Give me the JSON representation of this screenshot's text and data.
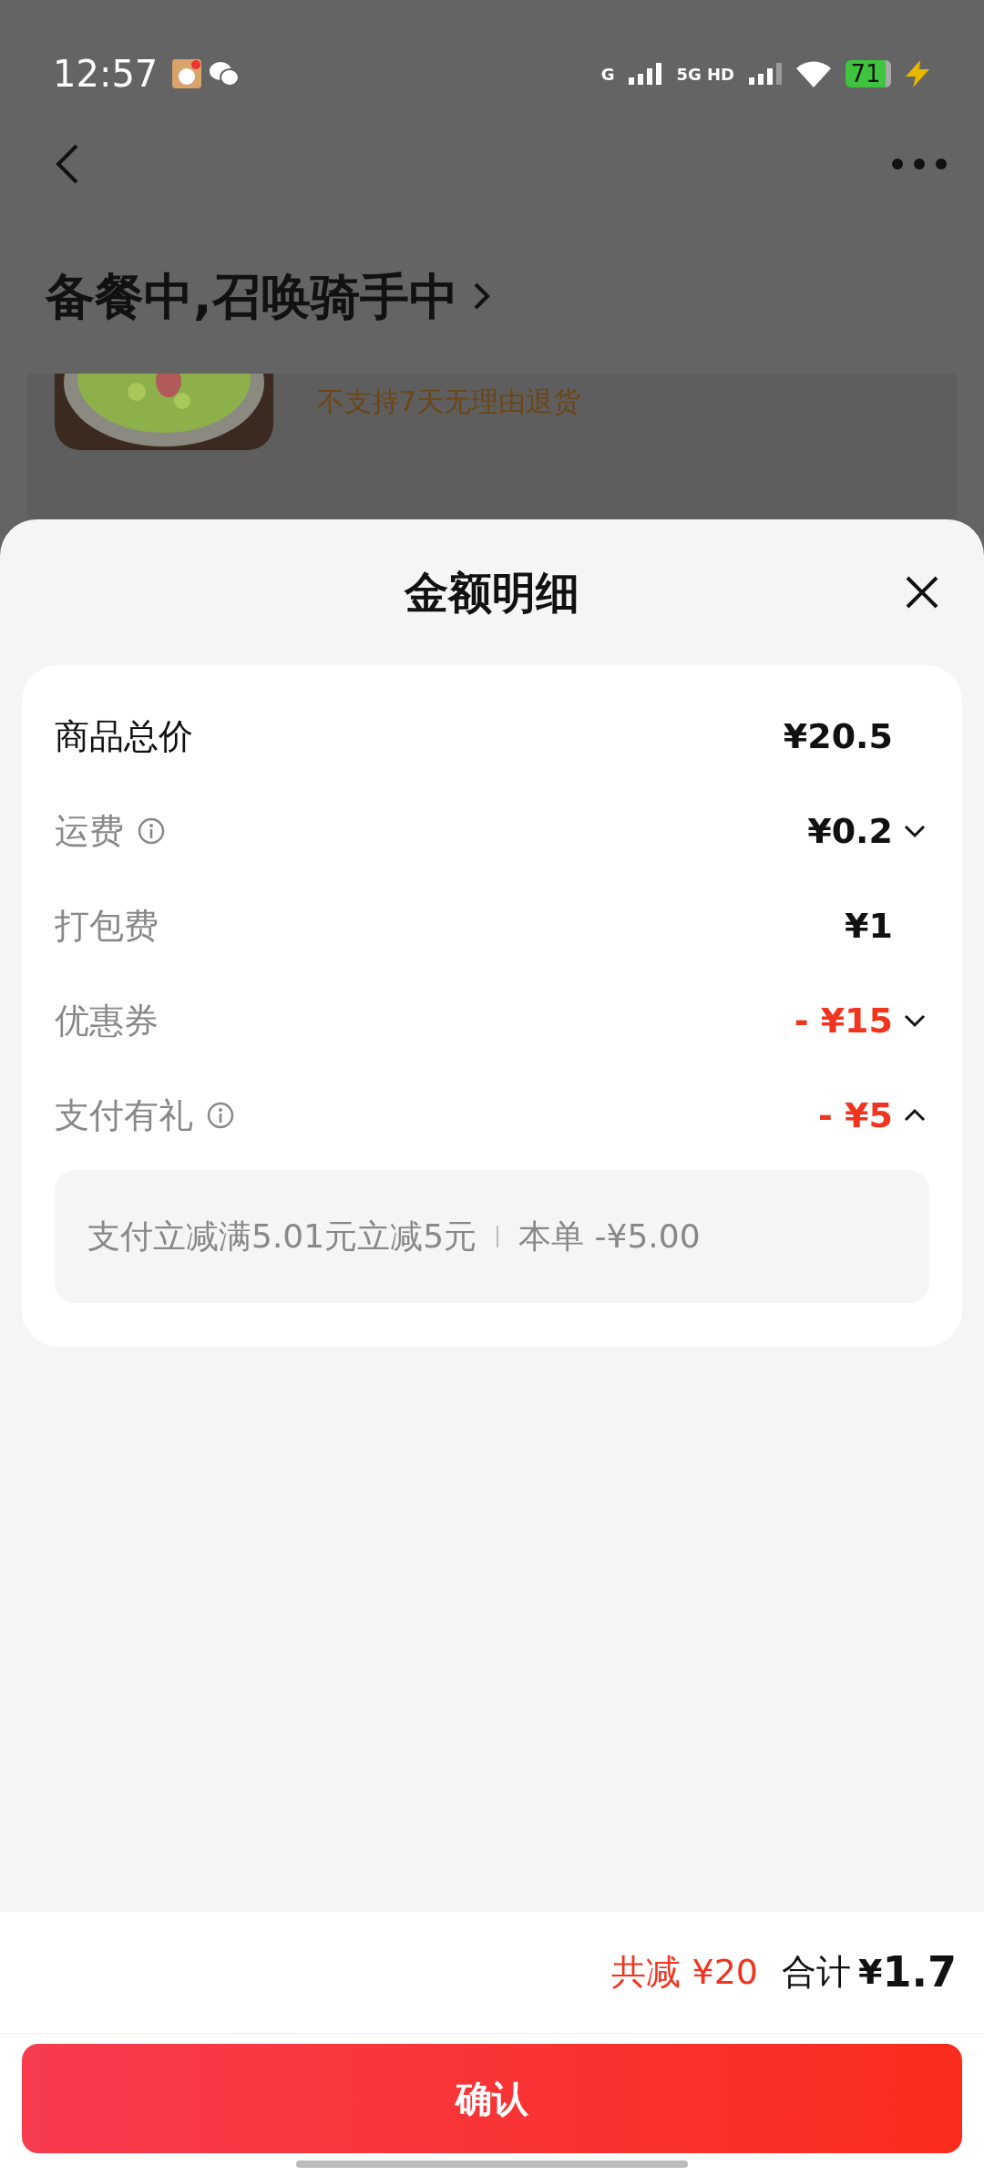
{
  "status_bar": {
    "time": "12:57",
    "network_1": "G",
    "network_2": "5G HD",
    "battery": "71"
  },
  "background_page": {
    "title": "备餐中,召唤骑手中",
    "item_note": "不支持7天无理由退货"
  },
  "sheet": {
    "title": "金额明细",
    "rows": [
      {
        "label": "商品总价",
        "info": false,
        "value": "¥20.5",
        "discount": false,
        "emphasis": true
      },
      {
        "label": "运费",
        "info": true,
        "value": "¥0.2",
        "discount": false,
        "emphasis": false,
        "expanded": false
      },
      {
        "label": "打包费",
        "info": false,
        "value": "¥1",
        "discount": false,
        "emphasis": false
      },
      {
        "label": "优惠券",
        "info": false,
        "value": "- ¥15",
        "discount": true,
        "emphasis": false,
        "expanded": false
      },
      {
        "label": "支付有礼",
        "info": true,
        "value": "- ¥5",
        "discount": true,
        "emphasis": false,
        "expanded": true,
        "detail": {
          "rule": "支付立减满5.01元立减5元",
          "amount": "本单 -¥5.00"
        }
      }
    ],
    "total_discount": "共减 ¥20",
    "total_label": "合计",
    "total_currency": "¥",
    "total_value": "1.7",
    "confirm": "确认"
  }
}
